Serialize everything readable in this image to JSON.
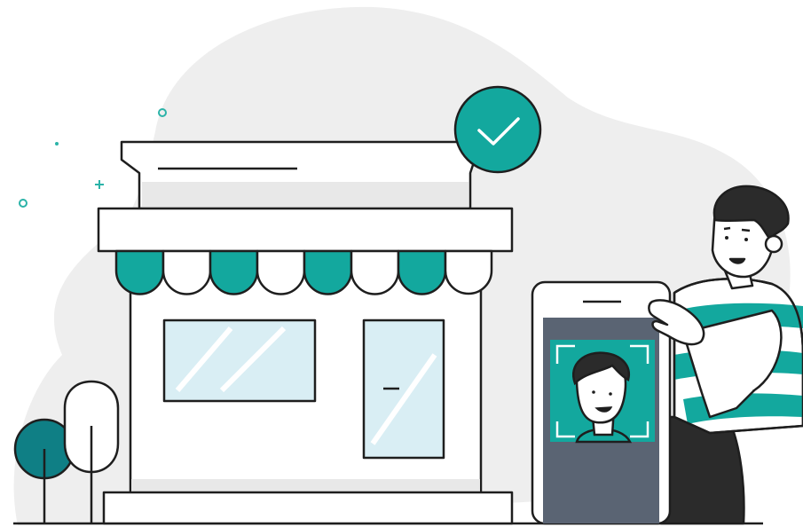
{
  "illustration": {
    "subject": "storefront-face-verification",
    "icons": [
      "check-icon",
      "face-scan-icon",
      "door-handle-icon"
    ]
  },
  "colors": {
    "teal": "#13a89e",
    "teal_dark": "#0f7f85",
    "outline": "#1e1e1e",
    "blob": "#eeeeee",
    "glass": "#d9eef4",
    "phone_screen": "#5a6473",
    "hair": "#2b2b2b",
    "skin": "#ffffff"
  }
}
